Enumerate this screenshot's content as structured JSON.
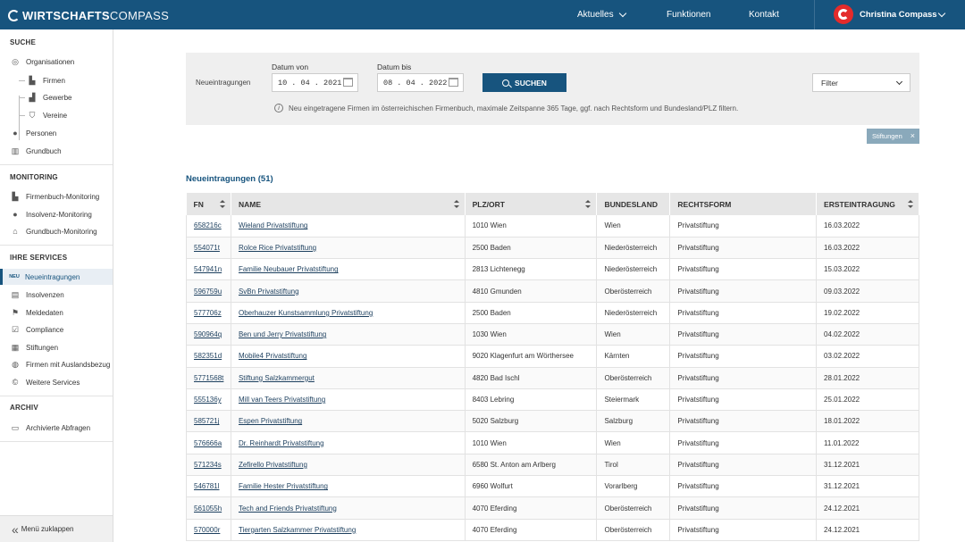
{
  "header": {
    "logo_bold": "WIRTSCHAFTS",
    "logo_light": "COMPASS",
    "nav": [
      {
        "label": "Aktuelles",
        "has_dropdown": true
      },
      {
        "label": "Funktionen",
        "has_dropdown": false
      },
      {
        "label": "Kontakt",
        "has_dropdown": false
      }
    ],
    "user_name": "Christina Compass"
  },
  "sidebar": {
    "sections": [
      {
        "title": "SUCHE",
        "items": [
          {
            "label": "Organisationen",
            "icon": "compass-icon"
          },
          {
            "label": "Firmen",
            "icon": "building-icon"
          },
          {
            "label": "Gewerbe",
            "icon": "factory-icon"
          },
          {
            "label": "Vereine",
            "icon": "shield-icon"
          },
          {
            "label": "Personen",
            "icon": "person-icon"
          },
          {
            "label": "Grundbuch",
            "icon": "book-icon"
          }
        ]
      },
      {
        "title": "MONITORING",
        "items": [
          {
            "label": "Firmenbuch-Monitoring",
            "icon": "building-plus-icon"
          },
          {
            "label": "Insolvenz-Monitoring",
            "icon": "person-plus-icon"
          },
          {
            "label": "Grundbuch-Monitoring",
            "icon": "house-plus-icon"
          }
        ]
      },
      {
        "title": "IHRE SERVICES",
        "items": [
          {
            "label": "Neueintragungen",
            "icon": "new-badge-icon",
            "badge": "NEU",
            "active": true
          },
          {
            "label": "Insolvenzen",
            "icon": "document-icon"
          },
          {
            "label": "Meldedaten",
            "icon": "flag-icon"
          },
          {
            "label": "Compliance",
            "icon": "checkbox-icon"
          },
          {
            "label": "Stiftungen",
            "icon": "grid-icon"
          },
          {
            "label": "Firmen mit Auslandsbezug",
            "icon": "globe-icon"
          },
          {
            "label": "Weitere Services",
            "icon": "copyright-icon"
          }
        ]
      },
      {
        "title": "ARCHIV",
        "items": [
          {
            "label": "Archivierte Abfragen",
            "icon": "archive-icon"
          }
        ]
      }
    ],
    "collapse_label": "Menü zuklappen"
  },
  "filter": {
    "label": "Neueintragungen",
    "date_from_label": "Datum von",
    "date_from_value": "10 . 04 . 2021",
    "date_to_label": "Datum bis",
    "date_to_value": "08 . 04 . 2022",
    "search_label": "SUCHEN",
    "filter_placeholder": "Filter",
    "info": "Neu eingetragene Firmen im österreichischen Firmenbuch, maximale Zeitspanne 365 Tage, ggf. nach Rechtsform und Bundesland/PLZ filtern.",
    "active_tag": "Stiftungen"
  },
  "results": {
    "heading": "Neueintragungen (51)",
    "columns": [
      "FN",
      "NAME",
      "PLZ/ORT",
      "BUNDESLAND",
      "RECHTSFORM",
      "ERSTEINTRAGUNG"
    ],
    "rows": [
      [
        "658216c",
        "Wieland Privatstiftung",
        "1010 Wien",
        "Wien",
        "Privatstiftung",
        "16.03.2022"
      ],
      [
        "554071t",
        "Rolce Rice Privatstiftung",
        "2500 Baden",
        "Niederösterreich",
        "Privatstiftung",
        "16.03.2022"
      ],
      [
        "547941n",
        "Familie Neubauer Privatstiftung",
        "2813 Lichtenegg",
        "Niederösterreich",
        "Privatstiftung",
        "15.03.2022"
      ],
      [
        "596759u",
        "SvBn Privatstiftung",
        "4810 Gmunden",
        "Oberösterreich",
        "Privatstiftung",
        "09.03.2022"
      ],
      [
        "577706z",
        "Oberhauzer Kunstsammlung Privatstiftung",
        "2500 Baden",
        "Niederösterreich",
        "Privatstiftung",
        "19.02.2022"
      ],
      [
        "590964q",
        "Ben und Jerry Privatstiftung",
        "1030 Wien",
        "Wien",
        "Privatstiftung",
        "04.02.2022"
      ],
      [
        "582351d",
        "Mobile4 Privatstiftung",
        "9020 Klagenfurt am Wörthersee",
        "Kärnten",
        "Privatstiftung",
        "03.02.2022"
      ],
      [
        "5771568t",
        "Stiftung Salzkammergut",
        "4820 Bad Ischl",
        "Oberösterreich",
        "Privatstiftung",
        "28.01.2022"
      ],
      [
        "555136y",
        "Mill van Teers Privatstiftung",
        "8403 Lebring",
        "Steiermark",
        "Privatstiftung",
        "25.01.2022"
      ],
      [
        "585721j",
        "Espen Privatstiftung",
        "5020 Salzburg",
        "Salzburg",
        "Privatstiftung",
        "18.01.2022"
      ],
      [
        "576666a",
        "Dr. Reinhardt Privatstiftung",
        "1010 Wien",
        "Wien",
        "Privatstiftung",
        "11.01.2022"
      ],
      [
        "571234s",
        "Zefirello Privatstiftung",
        "6580 St. Anton am Arlberg",
        "Tirol",
        "Privatstiftung",
        "31.12.2021"
      ],
      [
        "546781l",
        "Familie Hester Privatstiftung",
        "6960 Wolfurt",
        "Vorarlberg",
        "Privatstiftung",
        "31.12.2021"
      ],
      [
        "561055h",
        "Tech and Friends Privatstiftung",
        "4070 Eferding",
        "Oberösterreich",
        "Privatstiftung",
        "24.12.2021"
      ],
      [
        "570000r",
        "Tiergarten Salzkammer Privatstiftung",
        "4070 Eferding",
        "Oberösterreich",
        "Privatstiftung",
        "24.12.2021"
      ]
    ]
  },
  "colors": {
    "primary": "#17547e",
    "brand_red": "#e42b2b",
    "tag": "#8aa9bb"
  }
}
